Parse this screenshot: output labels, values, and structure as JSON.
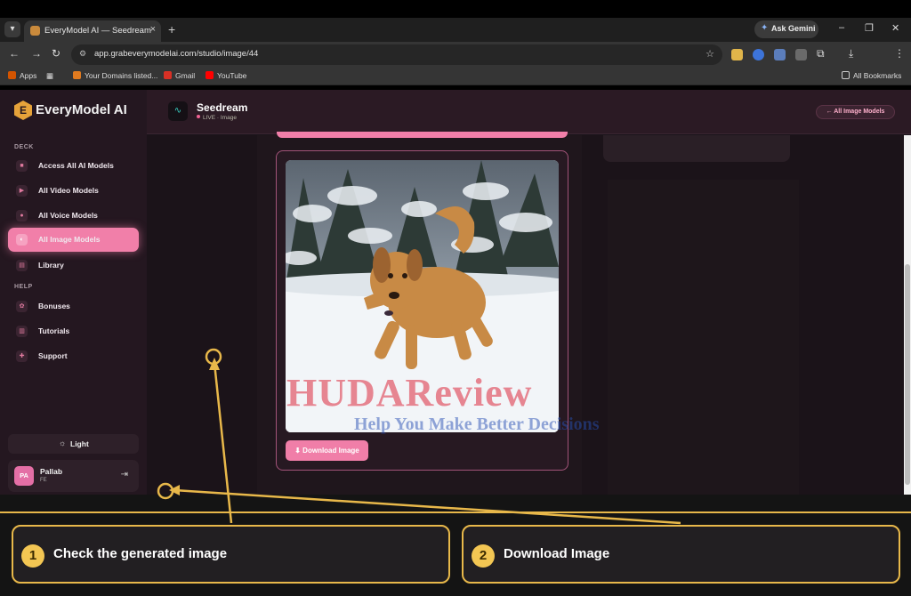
{
  "browser": {
    "tab_title": "EveryModel AI — Seedream",
    "gemini_label": "Ask Gemini",
    "url": "app.grabeverymodelai.com/studio/image/44",
    "bookmarks": [
      "Apps",
      "Your Domains listed...",
      "Gmail",
      "YouTube"
    ],
    "all_bookmarks_label": "All Bookmarks"
  },
  "sidebar": {
    "logo": "EveryModel AI",
    "sections": {
      "deck": "DECK",
      "help": "HELP"
    },
    "items": [
      {
        "label": "Access All AI Models",
        "icon": "grid-icon"
      },
      {
        "label": "All Video Models",
        "icon": "play-icon"
      },
      {
        "label": "All Voice Models",
        "icon": "mic-icon"
      },
      {
        "label": "All Image Models",
        "icon": "image-icon",
        "active": true
      },
      {
        "label": "Library",
        "icon": "library-icon"
      },
      {
        "label": "Bonuses",
        "icon": "gift-icon"
      },
      {
        "label": "Tutorials",
        "icon": "book-icon"
      },
      {
        "label": "Support",
        "icon": "support-icon"
      }
    ],
    "theme_toggle": "Light",
    "user": {
      "initials": "PA",
      "name": "Pallab",
      "role": "FE"
    }
  },
  "header": {
    "model_name": "Seedream",
    "status": "LIVE · Image",
    "back_button": "← All Image Models"
  },
  "result": {
    "download_label": "⬇ Download Image"
  },
  "watermark": {
    "title": "HUDAReview",
    "tagline": "Help You Make Better Decisions"
  },
  "steps": [
    {
      "number": "1",
      "label": "Check the generated image"
    },
    {
      "number": "2",
      "label": "Download Image"
    }
  ],
  "colors": {
    "accent": "#f17fa9",
    "step_border": "#e8b84a",
    "step_badge": "#f3c653"
  }
}
